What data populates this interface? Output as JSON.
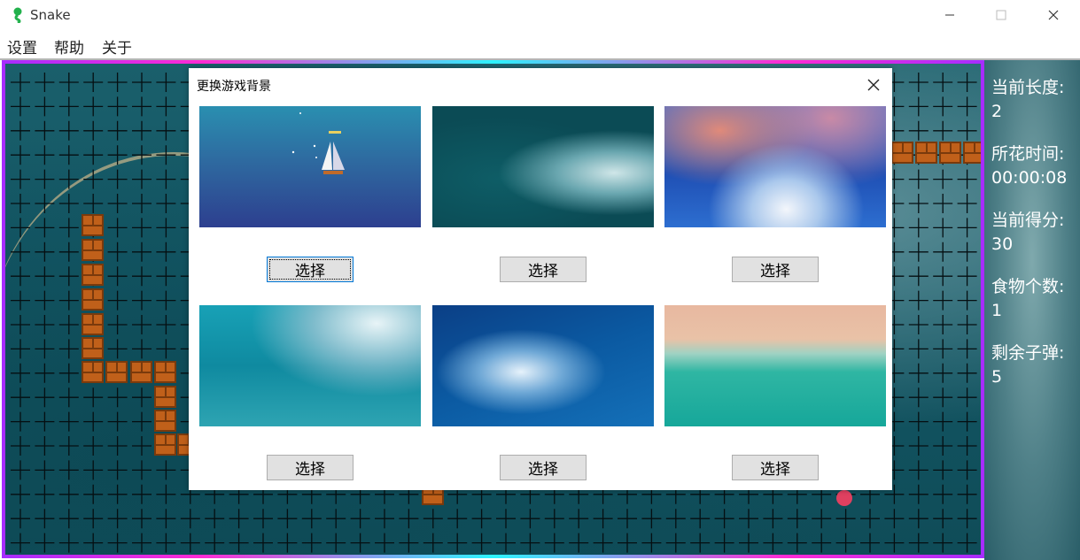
{
  "window": {
    "title": "Snake",
    "minimize_label": "—",
    "maximize_label": "☐",
    "close_label": "✕"
  },
  "menu": {
    "items": [
      "设置",
      "帮助",
      "关于"
    ]
  },
  "stats": [
    {
      "label": "当前长度:",
      "value": "2"
    },
    {
      "label": "所花时间:",
      "value": "00:00:08"
    },
    {
      "label": "当前得分:",
      "value": "30"
    },
    {
      "label": "食物个数:",
      "value": "1"
    },
    {
      "label": "剩余子弹:",
      "value": "5"
    }
  ],
  "dialog": {
    "title": "更换游戏背景",
    "close_label": "✕",
    "backgrounds": [
      {
        "button_label": "选择",
        "focused": true
      },
      {
        "button_label": "选择",
        "focused": false
      },
      {
        "button_label": "选择",
        "focused": false
      },
      {
        "button_label": "选择",
        "focused": false
      },
      {
        "button_label": "选择",
        "focused": false
      },
      {
        "button_label": "选择",
        "focused": false
      }
    ]
  },
  "colors": {
    "frame_gradient": [
      "#a72cff",
      "#ff2ad4",
      "#2cf4ff"
    ],
    "brick": "#c0601a",
    "food": "#e04060",
    "focus_border": "#0078d7"
  }
}
